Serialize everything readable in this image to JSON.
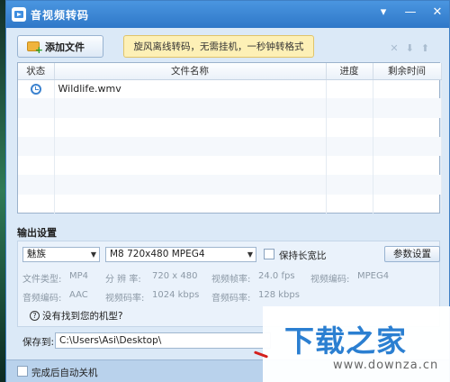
{
  "window": {
    "title": "音视频转码",
    "controls": [
      "▾",
      "—",
      "✕"
    ]
  },
  "toolbar": {
    "add_file_label": "添加文件",
    "promo_text": "旋风离线转码，无需挂机，一秒钟转格式"
  },
  "list_controls": [
    "✕",
    "⬇",
    "⬆"
  ],
  "table": {
    "headers": [
      "状态",
      "文件名称",
      "进度",
      "剩余时间"
    ],
    "rows": [
      {
        "status_icon": "clock-icon",
        "file": "Wildlife.wmv",
        "progress": "",
        "remaining": ""
      }
    ]
  },
  "output": {
    "section_title": "输出设置",
    "device_select": "魅族",
    "format_select": "M8 720x480 MPEG4",
    "keep_ratio_label": "保持长宽比",
    "param_button": "参数设置",
    "file_type_label": "文件类型:",
    "file_type_value": "MP4",
    "resolution_label": "分 辨 率:",
    "resolution_value": "720 x 480",
    "frame_rate_label": "视频帧率:",
    "frame_rate_value": "24.0 fps",
    "video_codec_label": "视频编码:",
    "video_codec_value": "MPEG4",
    "audio_codec_label": "音频编码:",
    "audio_codec_value": "AAC",
    "video_bitrate_label": "视频码率:",
    "video_bitrate_value": "1024 kbps",
    "audio_bitrate_label": "音频码率:",
    "audio_bitrate_value": "128 kbps",
    "help_text": "没有找到您的机型?"
  },
  "save": {
    "label": "保存到:",
    "path": "C:\\Users\\Asi\\Desktop\\"
  },
  "footer": {
    "shutdown_label": "完成后自动关机"
  },
  "watermark": {
    "main": "下载之家",
    "sub": "www.downza.cn"
  }
}
